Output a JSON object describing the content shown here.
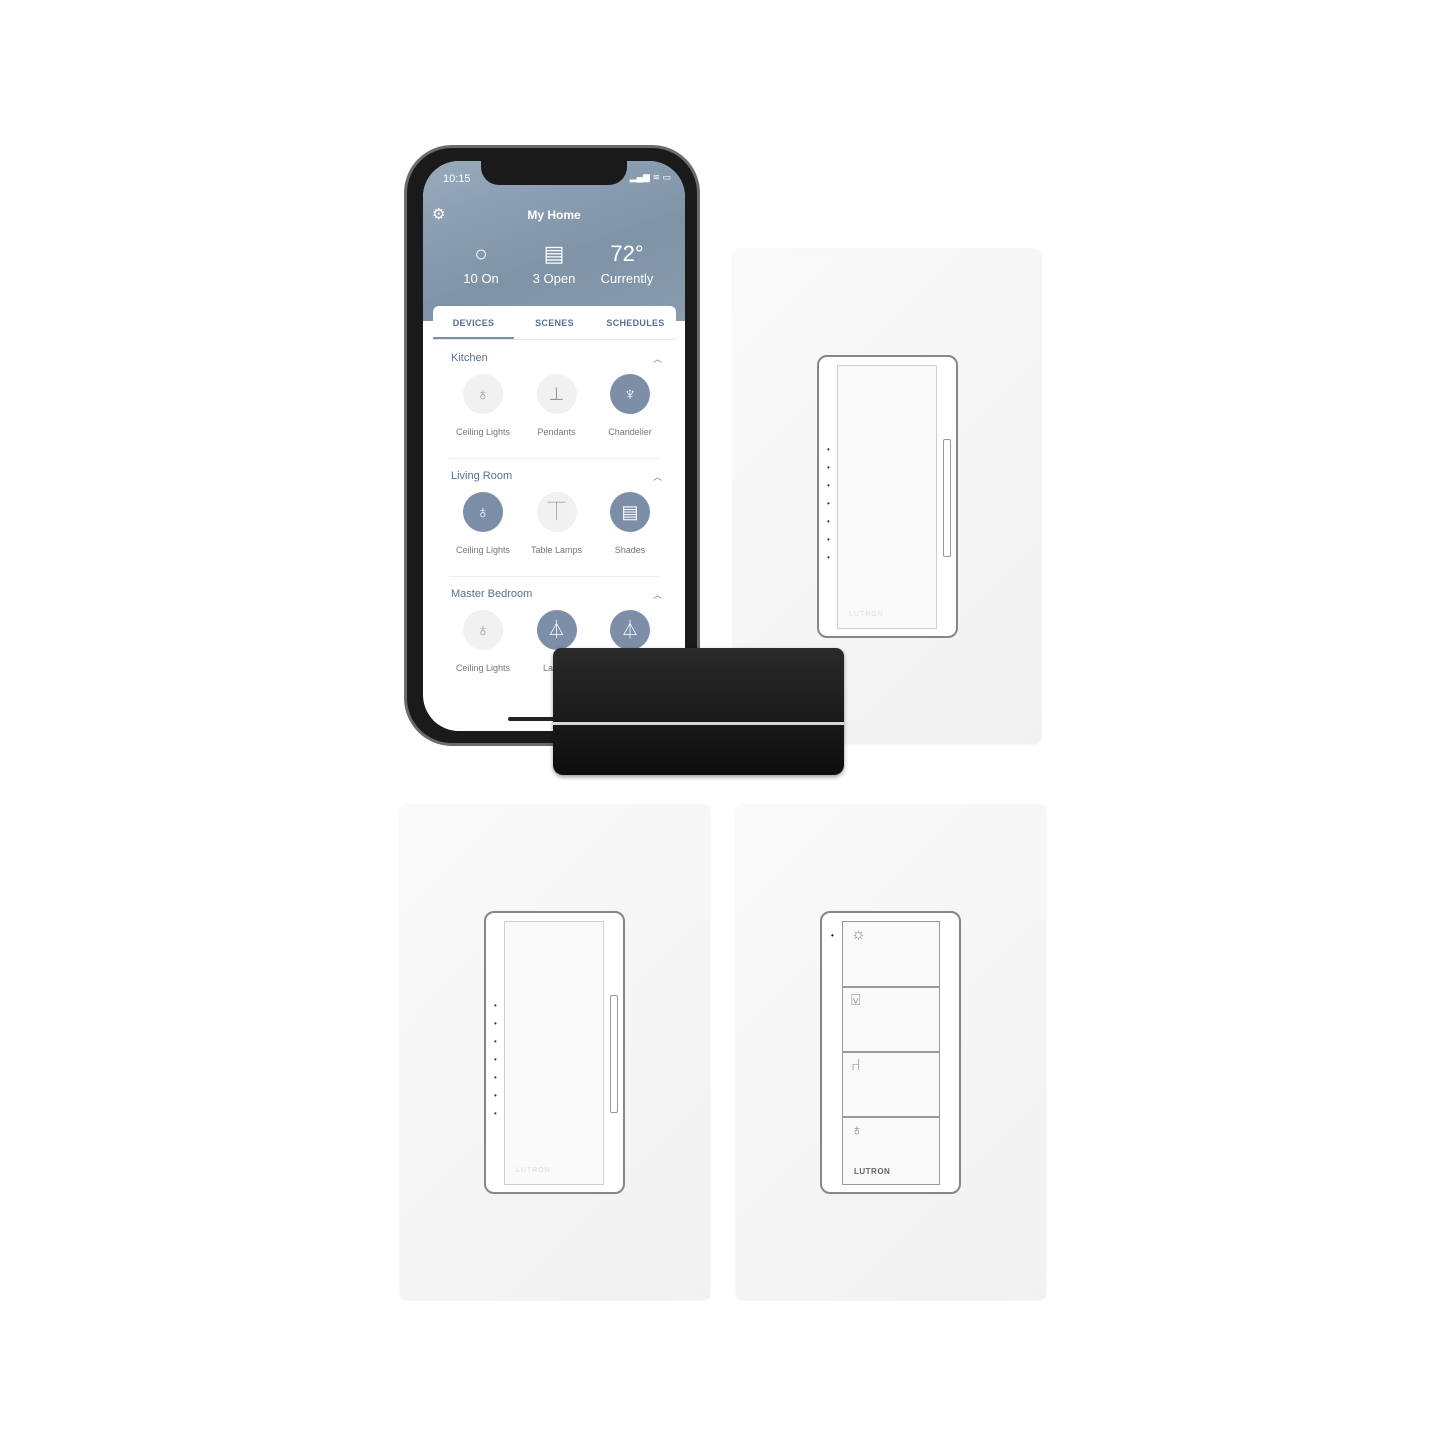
{
  "phone": {
    "status_time": "10:15",
    "app_title": "My Home",
    "stats": [
      {
        "icon": "lightbulb-icon",
        "glyph": "💡",
        "label": "10 On"
      },
      {
        "icon": "shade-window-icon",
        "glyph": "▤",
        "label": "3 Open"
      },
      {
        "icon": "temperature",
        "glyph": "72°",
        "label": "Currently"
      }
    ],
    "tabs": [
      "DEVICES",
      "SCENES",
      "SCHEDULES"
    ],
    "active_tab": "DEVICES",
    "accent_color": "#7c8ea8",
    "rooms": [
      {
        "name": "Kitchen",
        "devices": [
          {
            "label": "Ceiling Lights",
            "icon": "lightbulb-icon",
            "on": false
          },
          {
            "label": "Pendants",
            "icon": "pendant-icon",
            "on": false
          },
          {
            "label": "Chandelier",
            "icon": "chandelier-icon",
            "on": true
          }
        ]
      },
      {
        "name": "Living Room",
        "devices": [
          {
            "label": "Ceiling Lights",
            "icon": "lightbulb-icon",
            "on": true
          },
          {
            "label": "Table Lamps",
            "icon": "table-lamp-icon",
            "on": false
          },
          {
            "label": "Shades",
            "icon": "shade-icon",
            "on": true
          }
        ]
      },
      {
        "name": "Master Bedroom",
        "devices": [
          {
            "label": "Ceiling Lights",
            "icon": "lightbulb-icon",
            "on": false
          },
          {
            "label": "Lamps",
            "icon": "lamp-icon",
            "on": true
          },
          {
            "label": "",
            "icon": "lamp-icon",
            "on": true
          }
        ]
      }
    ]
  },
  "dimmer_brand": "LUTRON",
  "pico": {
    "brand": "LUTRON",
    "buttons": [
      "lightbulb-bright-icon",
      "cheers-icon",
      "armchair-icon",
      "lightbulb-icon"
    ]
  }
}
